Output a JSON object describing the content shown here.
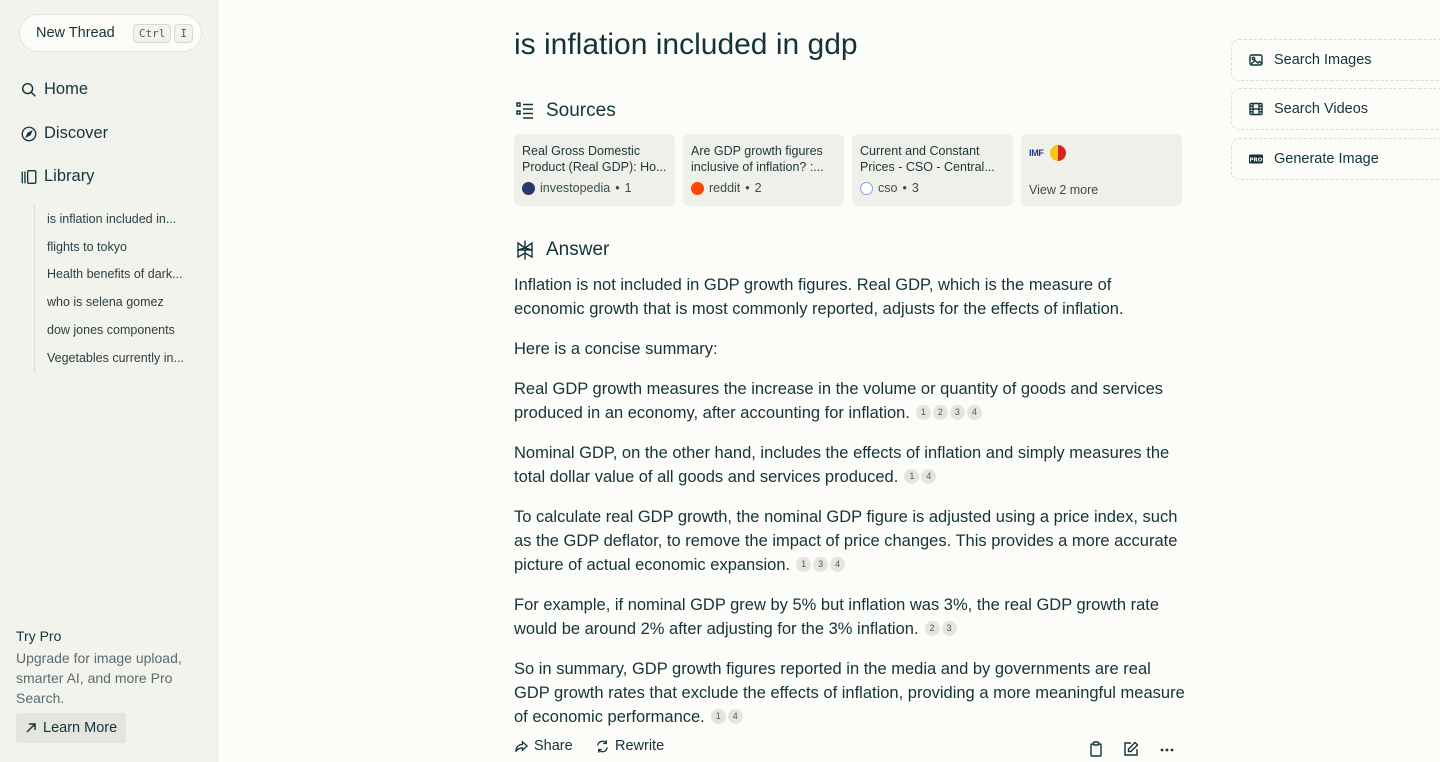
{
  "sidebar": {
    "new_thread": "New Thread",
    "shortcut_keys": [
      "Ctrl",
      "I"
    ],
    "nav": [
      {
        "label": "Home",
        "icon": "search-icon"
      },
      {
        "label": "Discover",
        "icon": "compass-icon"
      },
      {
        "label": "Library",
        "icon": "library-icon"
      }
    ],
    "library_items": [
      "is inflation included in...",
      "flights to tokyo",
      "Health benefits of dark...",
      "who is selena gomez",
      "dow jones components",
      "Vegetables currently in..."
    ],
    "try_pro_title": "Try Pro",
    "try_pro_text": "Upgrade for image upload, smarter AI, and more Pro Search.",
    "learn_more": "Learn More"
  },
  "thread": {
    "title": "is inflation included in gdp",
    "sources_heading": "Sources",
    "sources": [
      {
        "title": "Real Gross Domestic Product (Real GDP): Ho...",
        "site": "investopedia",
        "index": "1",
        "color": "#2a3a66"
      },
      {
        "title": "Are GDP growth figures inclusive of inflation? :...",
        "site": "reddit",
        "index": "2",
        "color": "#ff4500"
      },
      {
        "title": "Current and Constant Prices - CSO - Central...",
        "site": "cso",
        "index": "3",
        "color": "#8aa0d8"
      }
    ],
    "more_sources": {
      "logo_text": "IMF",
      "label": "View 2 more"
    },
    "answer_heading": "Answer",
    "paragraphs": [
      {
        "text": "Inflation is not included in GDP growth figures. Real GDP, which is the measure of economic growth that is most commonly reported, adjusts for the effects of inflation.",
        "cites": []
      },
      {
        "text": "Here is a concise summary:",
        "cites": []
      },
      {
        "text": "Real GDP growth measures the increase in the volume or quantity of goods and services produced in an economy, after accounting for inflation.",
        "cites": [
          "1",
          "2",
          "3",
          "4"
        ]
      },
      {
        "text": "Nominal GDP, on the other hand, includes the effects of inflation and simply measures the total dollar value of all goods and services produced.",
        "cites": [
          "1",
          "4"
        ]
      },
      {
        "text": "To calculate real GDP growth, the nominal GDP figure is adjusted using a price index, such as the GDP deflator, to remove the impact of price changes. This provides a more accurate picture of actual economic expansion.",
        "cites": [
          "1",
          "3",
          "4"
        ]
      },
      {
        "text": "For example, if nominal GDP grew by 5% but inflation was 3%, the real GDP growth rate would be around 2% after adjusting for the 3% inflation.",
        "cites": [
          "2",
          "3"
        ]
      },
      {
        "text": "So in summary, GDP growth figures reported in the media and by governments are real GDP growth rates that exclude the effects of inflation, providing a more meaningful measure of economic performance.",
        "cites": [
          "1",
          "4"
        ]
      }
    ],
    "actions": {
      "share": "Share",
      "rewrite": "Rewrite"
    }
  },
  "right_panel": [
    {
      "label": "Search Images",
      "icon": "image-icon"
    },
    {
      "label": "Search Videos",
      "icon": "film-icon"
    },
    {
      "label": "Generate Image",
      "icon": "pro-badge-icon"
    }
  ]
}
